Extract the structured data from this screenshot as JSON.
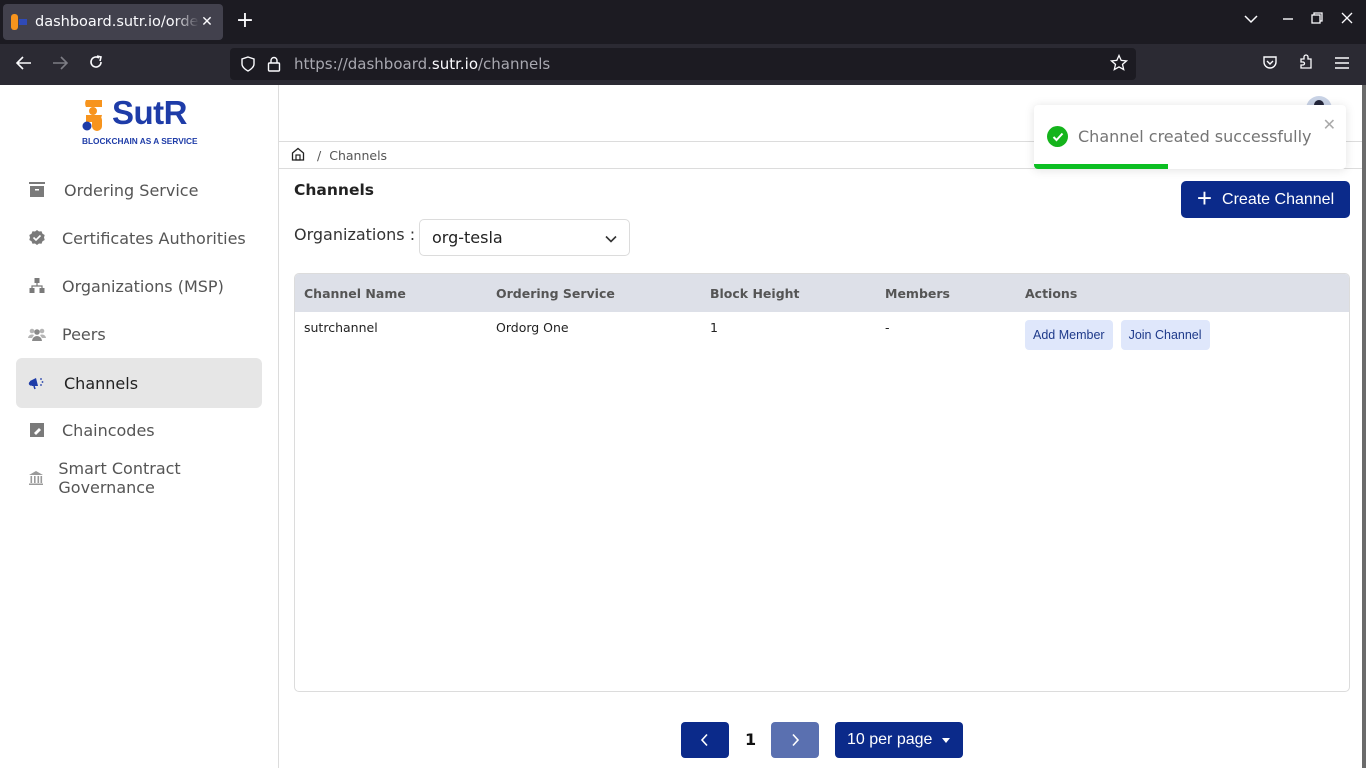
{
  "browser": {
    "tab_title": "dashboard.sutr.io/ordering",
    "url_prefix": "https://dashboard.",
    "url_domain": "sutr.io",
    "url_path": "/channels"
  },
  "sidebar": {
    "logo_text": "SutR",
    "logo_tagline": "BLOCKCHAIN AS A SERVICE",
    "brand_colors": {
      "orange": "#f7941d",
      "blue": "#1e3ca8"
    },
    "items": [
      {
        "label": "Ordering Service",
        "icon": "archive-box-icon",
        "active": false
      },
      {
        "label": "Certificates Authorities",
        "icon": "verified-badge-icon",
        "active": false
      },
      {
        "label": "Organizations (MSP)",
        "icon": "org-hierarchy-icon",
        "active": false
      },
      {
        "label": "Peers",
        "icon": "users-group-icon",
        "active": false
      },
      {
        "label": "Channels",
        "icon": "megaphone-icon",
        "active": true
      },
      {
        "label": "Chaincodes",
        "icon": "tag-icon",
        "active": false
      },
      {
        "label": "Smart Contract Governance",
        "icon": "bank-building-icon",
        "active": false
      }
    ]
  },
  "breadcrumb": {
    "home_icon": "home-icon",
    "current": "Channels"
  },
  "page": {
    "title": "Channels",
    "create_button": "Create Channel",
    "org_label": "Organizations :",
    "org_selected": "org-tesla"
  },
  "table": {
    "columns": [
      "Channel Name",
      "Ordering Service",
      "Block Height",
      "Members",
      "Actions"
    ],
    "rows": [
      {
        "channel_name": "sutrchannel",
        "ordering_service": "Ordorg One",
        "block_height": "1",
        "members": "-",
        "actions": [
          "Add Member",
          "Join Channel"
        ]
      }
    ]
  },
  "pagination": {
    "current_page": "1",
    "per_page": "10 per page"
  },
  "toast": {
    "message": "Channel created successfully",
    "type": "success",
    "progress_fraction": 0.43,
    "color": "#0cbf22"
  },
  "colors": {
    "primary": "#0b2a8a",
    "primary_disabled": "#5a70b0",
    "action_bg": "#dfe7fb",
    "table_header_bg": "#dde0e8"
  }
}
